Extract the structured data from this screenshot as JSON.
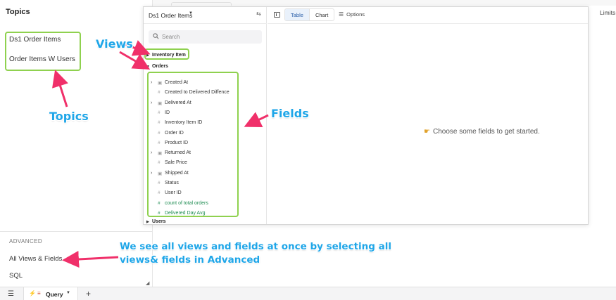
{
  "app": {
    "limits_label": "Limits"
  },
  "topics_panel": {
    "title": "Topics",
    "items": [
      {
        "label": "Ds1 Order Items"
      },
      {
        "label": "Order Items W Users"
      }
    ],
    "advanced": {
      "title": "ADVANCED",
      "items": [
        {
          "label": "All Views & Fields"
        },
        {
          "label": "SQL"
        }
      ]
    }
  },
  "query": {
    "topic_label": "Ds1 Order Items",
    "search_placeholder": "Search",
    "views": [
      {
        "label": "Inventory Item"
      },
      {
        "label": "Orders"
      },
      {
        "label": "Users"
      }
    ],
    "fields": [
      {
        "label": "Created At",
        "type": "date",
        "expandable": true
      },
      {
        "label": "Created to Delivered Diffence",
        "type": "number",
        "expandable": false
      },
      {
        "label": "Delivered At",
        "type": "date",
        "expandable": true
      },
      {
        "label": "ID",
        "type": "number",
        "expandable": false
      },
      {
        "label": "Inventory Item ID",
        "type": "number",
        "expandable": false
      },
      {
        "label": "Order ID",
        "type": "number",
        "expandable": false
      },
      {
        "label": "Product ID",
        "type": "number",
        "expandable": false
      },
      {
        "label": "Returned At",
        "type": "date",
        "expandable": true
      },
      {
        "label": "Sale Price",
        "type": "number",
        "expandable": false
      },
      {
        "label": "Shipped At",
        "type": "date",
        "expandable": true
      },
      {
        "label": "Status",
        "type": "number",
        "expandable": false
      },
      {
        "label": "User ID",
        "type": "number",
        "expandable": false
      },
      {
        "label": "count of total orders",
        "type": "measure",
        "expandable": false
      },
      {
        "label": "Delivered Day Avg",
        "type": "measure",
        "expandable": false
      }
    ],
    "toolbar": {
      "table_label": "Table",
      "chart_label": "Chart",
      "options_label": "Options"
    },
    "empty_message": "Choose some fields to get started."
  },
  "tabbar": {
    "tab_label": "Query"
  },
  "annotations": {
    "views": "Views",
    "topics": "Topics",
    "fields": "Fields",
    "advanced_line1": "We see all views and fields  at once by selecting all",
    "advanced_line2": "views& fields in Advanced"
  },
  "colors": {
    "highlight": "#8fd14f",
    "arrow": "#f0306a",
    "annotation_text": "#1fa6e8",
    "measure_text": "#1c8b50",
    "accent": "#2a5ea8"
  },
  "icons": {
    "search": "search-icon",
    "date_field": "calendar-icon",
    "number_field": "hash-icon",
    "empty_state": "pointing-hand-icon",
    "bolt": "lightning-icon"
  }
}
